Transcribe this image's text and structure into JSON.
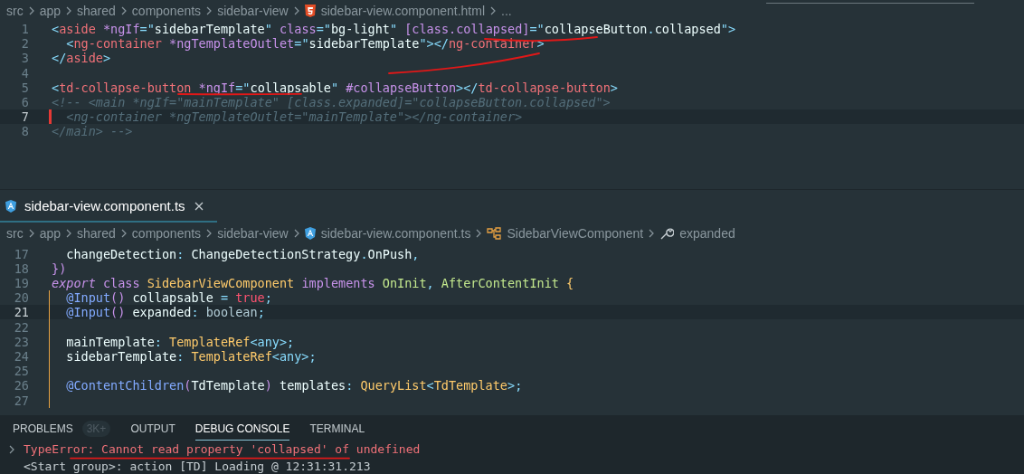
{
  "editors": [
    {
      "breadcrumb": [
        {
          "text": "src",
          "kind": "folder"
        },
        {
          "text": "app",
          "kind": "folder"
        },
        {
          "text": "shared",
          "kind": "folder"
        },
        {
          "text": "components",
          "kind": "folder"
        },
        {
          "text": "sidebar-view",
          "kind": "folder"
        },
        {
          "text": "sidebar-view.component.html",
          "kind": "html"
        },
        {
          "text": "...",
          "kind": "more"
        }
      ],
      "lines": [
        {
          "number": "1",
          "current": false,
          "modified": false,
          "scope": false,
          "tokens": [
            {
              "text": "<",
              "kind": "punct"
            },
            {
              "text": "aside",
              "kind": "tag"
            },
            {
              "text": " *ngIf",
              "kind": "attr"
            },
            {
              "text": "=\"",
              "kind": "punct"
            },
            {
              "text": "sidebarTemplate",
              "kind": "string"
            },
            {
              "text": "\"",
              "kind": "punct"
            },
            {
              "text": " class",
              "kind": "attr"
            },
            {
              "text": "=\"",
              "kind": "punct"
            },
            {
              "text": "bg-light",
              "kind": "string"
            },
            {
              "text": "\"",
              "kind": "punct"
            },
            {
              "text": " [class.collapsed]",
              "kind": "attr"
            },
            {
              "text": "=\"",
              "kind": "punct"
            },
            {
              "text": "collapseButton",
              "kind": "string"
            },
            {
              "text": ".",
              "kind": "punct"
            },
            {
              "text": "collapsed",
              "kind": "string"
            },
            {
              "text": "\">",
              "kind": "punct"
            }
          ]
        },
        {
          "number": "2",
          "current": false,
          "modified": false,
          "scope": false,
          "tokens": [
            {
              "text": "  <",
              "kind": "punct"
            },
            {
              "text": "ng-container",
              "kind": "tag"
            },
            {
              "text": " *ngTemplateOutlet",
              "kind": "attr"
            },
            {
              "text": "=\"",
              "kind": "punct"
            },
            {
              "text": "sidebarTemplate",
              "kind": "string"
            },
            {
              "text": "\"></",
              "kind": "punct"
            },
            {
              "text": "ng-container",
              "kind": "tag"
            },
            {
              "text": ">",
              "kind": "punct"
            }
          ]
        },
        {
          "number": "3",
          "current": false,
          "modified": false,
          "scope": false,
          "tokens": [
            {
              "text": "</",
              "kind": "punct"
            },
            {
              "text": "aside",
              "kind": "tag"
            },
            {
              "text": ">",
              "kind": "punct"
            }
          ]
        },
        {
          "number": "4",
          "current": false,
          "modified": false,
          "scope": false
        },
        {
          "number": "5",
          "current": false,
          "modified": false,
          "scope": false,
          "tokens": [
            {
              "text": "<",
              "kind": "punct"
            },
            {
              "text": "td-collapse-button",
              "kind": "tag"
            },
            {
              "text": " *ngIf",
              "kind": "attr"
            },
            {
              "text": "=\"",
              "kind": "punct"
            },
            {
              "text": "collapsable",
              "kind": "string"
            },
            {
              "text": "\"",
              "kind": "punct"
            },
            {
              "text": " #collapseButton",
              "kind": "attr"
            },
            {
              "text": "></",
              "kind": "punct"
            },
            {
              "text": "td-collapse-button",
              "kind": "tag"
            },
            {
              "text": ">",
              "kind": "punct"
            }
          ]
        },
        {
          "number": "6",
          "current": false,
          "modified": false,
          "scope": false,
          "tokens": [
            {
              "text": "<!-- <main *ngIf=\"mainTemplate\" [class.expanded]=\"collapseButton.collapsed\">",
              "kind": "comment"
            }
          ]
        },
        {
          "number": "7",
          "current": true,
          "modified": true,
          "scope": false,
          "tokens": [
            {
              "text": "  <ng-container *ngTemplateOutlet=\"mainTemplate\"></ng-container>",
              "kind": "comment"
            }
          ]
        },
        {
          "number": "8",
          "current": false,
          "modified": false,
          "scope": false,
          "tokens": [
            {
              "text": "</main> -->",
              "kind": "comment"
            }
          ]
        }
      ]
    },
    {
      "tab": {
        "title": "sidebar-view.component.ts",
        "selected": true
      },
      "breadcrumb": [
        {
          "text": "src",
          "kind": "folder"
        },
        {
          "text": "app",
          "kind": "folder"
        },
        {
          "text": "shared",
          "kind": "folder"
        },
        {
          "text": "components",
          "kind": "folder"
        },
        {
          "text": "sidebar-view",
          "kind": "folder"
        },
        {
          "text": "sidebar-view.component.ts",
          "kind": "angular"
        },
        {
          "text": "SidebarViewComponent",
          "kind": "class"
        },
        {
          "text": "expanded",
          "kind": "property"
        }
      ],
      "lines": [
        {
          "number": "17",
          "current": false,
          "modified": false,
          "scope": false,
          "tokens": [
            {
              "text": "  changeDetection",
              "kind": "plain"
            },
            {
              "text": ": ",
              "kind": "punct"
            },
            {
              "text": "ChangeDetectionStrategy",
              "kind": "plain"
            },
            {
              "text": ".",
              "kind": "punct"
            },
            {
              "text": "OnPush",
              "kind": "plain"
            },
            {
              "text": ",",
              "kind": "punct"
            }
          ]
        },
        {
          "number": "18",
          "current": false,
          "modified": false,
          "scope": false,
          "tokens": [
            {
              "text": "})",
              "kind": "bracket"
            }
          ]
        },
        {
          "number": "19",
          "current": false,
          "modified": false,
          "scope": false,
          "tokens": [
            {
              "text": "export",
              "kind": "keyword-italic"
            },
            {
              "text": " class ",
              "kind": "keyword"
            },
            {
              "text": "SidebarViewComponent",
              "kind": "type"
            },
            {
              "text": " implements ",
              "kind": "keyword"
            },
            {
              "text": "OnInit",
              "kind": "interface"
            },
            {
              "text": ", ",
              "kind": "punct"
            },
            {
              "text": "AfterContentInit",
              "kind": "interface"
            },
            {
              "text": " {",
              "kind": "type"
            }
          ]
        },
        {
          "number": "20",
          "current": false,
          "modified": false,
          "scope": true,
          "tokens": [
            {
              "text": "  @Input",
              "kind": "func"
            },
            {
              "text": "()",
              "kind": "keyword"
            },
            {
              "text": " collapsable ",
              "kind": "plain"
            },
            {
              "text": "=",
              "kind": "punct"
            },
            {
              "text": " true",
              "kind": "bool"
            },
            {
              "text": ";",
              "kind": "punct"
            }
          ]
        },
        {
          "number": "21",
          "current": true,
          "modified": false,
          "scope": true,
          "tokens": [
            {
              "text": "  @Input",
              "kind": "func"
            },
            {
              "text": "()",
              "kind": "keyword"
            },
            {
              "text": " expanded",
              "kind": "plain"
            },
            {
              "text": ": ",
              "kind": "punct"
            },
            {
              "text": "boolean",
              "kind": "builtin"
            },
            {
              "text": ";",
              "kind": "punct"
            }
          ]
        },
        {
          "number": "22",
          "current": false,
          "modified": false,
          "scope": true
        },
        {
          "number": "23",
          "current": false,
          "modified": false,
          "scope": true,
          "tokens": [
            {
              "text": "  mainTemplate",
              "kind": "plain"
            },
            {
              "text": ": ",
              "kind": "punct"
            },
            {
              "text": "TemplateRef",
              "kind": "type"
            },
            {
              "text": "<any>",
              "kind": "punct"
            },
            {
              "text": ";",
              "kind": "punct"
            }
          ]
        },
        {
          "number": "24",
          "current": false,
          "modified": false,
          "scope": true,
          "tokens": [
            {
              "text": "  sidebarTemplate",
              "kind": "plain"
            },
            {
              "text": ": ",
              "kind": "punct"
            },
            {
              "text": "TemplateRef",
              "kind": "type"
            },
            {
              "text": "<any>",
              "kind": "punct"
            },
            {
              "text": ";",
              "kind": "punct"
            }
          ]
        },
        {
          "number": "25",
          "current": false,
          "modified": false,
          "scope": true
        },
        {
          "number": "26",
          "current": false,
          "modified": false,
          "scope": true,
          "tokens": [
            {
              "text": "  @ContentChildren",
              "kind": "func"
            },
            {
              "text": "(",
              "kind": "keyword"
            },
            {
              "text": "TdTemplate",
              "kind": "plain"
            },
            {
              "text": ")",
              "kind": "keyword"
            },
            {
              "text": " templates",
              "kind": "plain"
            },
            {
              "text": ": ",
              "kind": "punct"
            },
            {
              "text": "QueryList",
              "kind": "type"
            },
            {
              "text": "<",
              "kind": "punct"
            },
            {
              "text": "TdTemplate",
              "kind": "type"
            },
            {
              "text": ">;",
              "kind": "punct"
            }
          ]
        },
        {
          "number": "27",
          "current": false,
          "modified": false,
          "scope": true
        }
      ]
    }
  ],
  "panel": {
    "tabs": [
      {
        "label": "PROBLEMS",
        "badge": "3K+",
        "selected": false
      },
      {
        "label": "OUTPUT",
        "selected": false
      },
      {
        "label": "DEBUG CONSOLE",
        "selected": true
      },
      {
        "label": "TERMINAL",
        "selected": false
      }
    ],
    "console": [
      {
        "kind": "error",
        "text": "TypeError: Cannot read property 'collapsed' of undefined"
      },
      {
        "kind": "log",
        "text": "<Start group>: action [TD] Loading @ 12:31:31.213"
      }
    ]
  }
}
